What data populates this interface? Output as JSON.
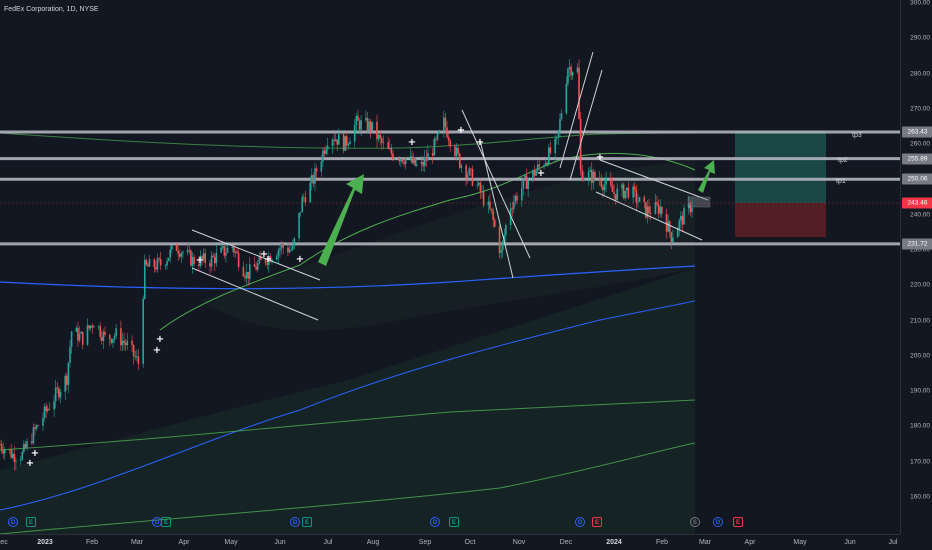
{
  "header": {
    "title": "FedEx Corporation, 1D, NYSE"
  },
  "price_axis": {
    "ticks": [
      "300.00",
      "290.00",
      "280.00",
      "270.00",
      "260.00",
      "250.00",
      "240.00",
      "230.00",
      "220.00",
      "210.00",
      "200.00",
      "190.00",
      "180.00",
      "170.00",
      "160.00"
    ],
    "levels": [
      {
        "label": "263.43",
        "price": 263.43,
        "bg": "#787b86",
        "color": "#ffffff"
      },
      {
        "label": "255.89",
        "price": 255.89,
        "bg": "#787b86",
        "color": "#ffffff"
      },
      {
        "label": "250.06",
        "price": 250.06,
        "bg": "#787b86",
        "color": "#ffffff"
      },
      {
        "label": "243.46",
        "price": 243.46,
        "bg": "#f23645",
        "color": "#ffffff"
      },
      {
        "label": "231.72",
        "price": 231.72,
        "bg": "#787b86",
        "color": "#ffffff"
      }
    ]
  },
  "time_axis": {
    "ticks": [
      {
        "label": "ec",
        "bold": false
      },
      {
        "label": "2023",
        "bold": true
      },
      {
        "label": "Feb",
        "bold": false
      },
      {
        "label": "Mar",
        "bold": false
      },
      {
        "label": "Apr",
        "bold": false
      },
      {
        "label": "May",
        "bold": false
      },
      {
        "label": "Jun",
        "bold": false
      },
      {
        "label": "Jul",
        "bold": false
      },
      {
        "label": "Aug",
        "bold": false
      },
      {
        "label": "Sep",
        "bold": false
      },
      {
        "label": "Oct",
        "bold": false
      },
      {
        "label": "Nov",
        "bold": false
      },
      {
        "label": "Dec",
        "bold": false
      },
      {
        "label": "2024",
        "bold": true
      },
      {
        "label": "Feb",
        "bold": false
      },
      {
        "label": "Mar",
        "bold": false
      },
      {
        "label": "Apr",
        "bold": false
      },
      {
        "label": "May",
        "bold": false
      },
      {
        "label": "Jun",
        "bold": false
      },
      {
        "label": "Jul",
        "bold": false
      }
    ]
  },
  "targets": {
    "tp3": "tp3",
    "tp2": "tp2",
    "tp1": "tp1"
  },
  "events": [
    {
      "glyph": "D",
      "kind": "div"
    },
    {
      "glyph": "E",
      "kind": "earn"
    },
    {
      "glyph": "D",
      "kind": "div"
    },
    {
      "glyph": "E",
      "kind": "earn"
    },
    {
      "glyph": "D",
      "kind": "div"
    },
    {
      "glyph": "E",
      "kind": "earn"
    },
    {
      "glyph": "D",
      "kind": "div"
    },
    {
      "glyph": "E",
      "kind": "earn"
    },
    {
      "glyph": "D",
      "kind": "div"
    },
    {
      "glyph": "E",
      "kind": "earn-red"
    },
    {
      "glyph": "S",
      "kind": "split"
    },
    {
      "glyph": "D",
      "kind": "div"
    },
    {
      "glyph": "E",
      "kind": "earn-red"
    }
  ],
  "colors": {
    "background": "#131722",
    "up": "#26a69a",
    "down": "#ef5350",
    "ma_blue": "#2962ff",
    "ma_green": "#4caf50",
    "arrow": "#4caf50",
    "level_line": "#b2b5be",
    "profit_zone": "#1b4e4a",
    "loss_zone": "#5a1e26"
  },
  "chart_data": {
    "type": "candlestick",
    "symbol": "FedEx Corporation",
    "interval": "1D",
    "exchange": "NYSE",
    "ylim": [
      155,
      302
    ],
    "horizontal_levels": [
      263.43,
      255.89,
      250.06,
      231.72
    ],
    "entry": 243.46,
    "stop": 231.72,
    "target": 263.43,
    "close_path": [
      [
        "2022-12-20",
        175
      ],
      [
        "2022-12-28",
        172
      ],
      [
        "2023-01-03",
        172
      ],
      [
        "2023-01-10",
        178
      ],
      [
        "2023-01-20",
        186
      ],
      [
        "2023-01-31",
        194
      ],
      [
        "2023-02-03",
        207
      ],
      [
        "2023-02-10",
        205
      ],
      [
        "2023-02-17",
        210
      ],
      [
        "2023-02-24",
        205
      ],
      [
        "2023-03-03",
        206
      ],
      [
        "2023-03-10",
        203
      ],
      [
        "2023-03-17",
        198
      ],
      [
        "2023-03-21",
        225
      ],
      [
        "2023-03-31",
        226
      ],
      [
        "2023-04-10",
        231
      ],
      [
        "2023-04-20",
        227
      ],
      [
        "2023-05-01",
        227
      ],
      [
        "2023-05-15",
        231
      ],
      [
        "2023-05-24",
        223
      ],
      [
        "2023-06-01",
        226
      ],
      [
        "2023-06-15",
        231
      ],
      [
        "2023-06-22",
        230
      ],
      [
        "2023-06-28",
        244
      ],
      [
        "2023-07-05",
        250
      ],
      [
        "2023-07-15",
        263
      ],
      [
        "2023-07-25",
        260
      ],
      [
        "2023-08-01",
        266
      ],
      [
        "2023-08-10",
        265
      ],
      [
        "2023-08-20",
        258
      ],
      [
        "2023-09-01",
        256
      ],
      [
        "2023-09-10",
        253
      ],
      [
        "2023-09-20",
        260
      ],
      [
        "2023-09-25",
        266
      ],
      [
        "2023-10-05",
        255
      ],
      [
        "2023-10-15",
        249
      ],
      [
        "2023-10-25",
        240
      ],
      [
        "2023-10-31",
        229
      ],
      [
        "2023-11-05",
        242
      ],
      [
        "2023-11-15",
        249
      ],
      [
        "2023-11-25",
        254
      ],
      [
        "2023-12-05",
        260
      ],
      [
        "2023-12-12",
        282
      ],
      [
        "2023-12-18",
        281
      ],
      [
        "2023-12-20",
        252
      ],
      [
        "2024-01-01",
        250
      ],
      [
        "2024-01-10",
        246
      ],
      [
        "2024-01-20",
        247
      ],
      [
        "2024-01-30",
        241
      ],
      [
        "2024-02-08",
        242
      ],
      [
        "2024-02-15",
        234
      ],
      [
        "2024-02-22",
        239
      ],
      [
        "2024-02-28",
        243
      ]
    ]
  }
}
